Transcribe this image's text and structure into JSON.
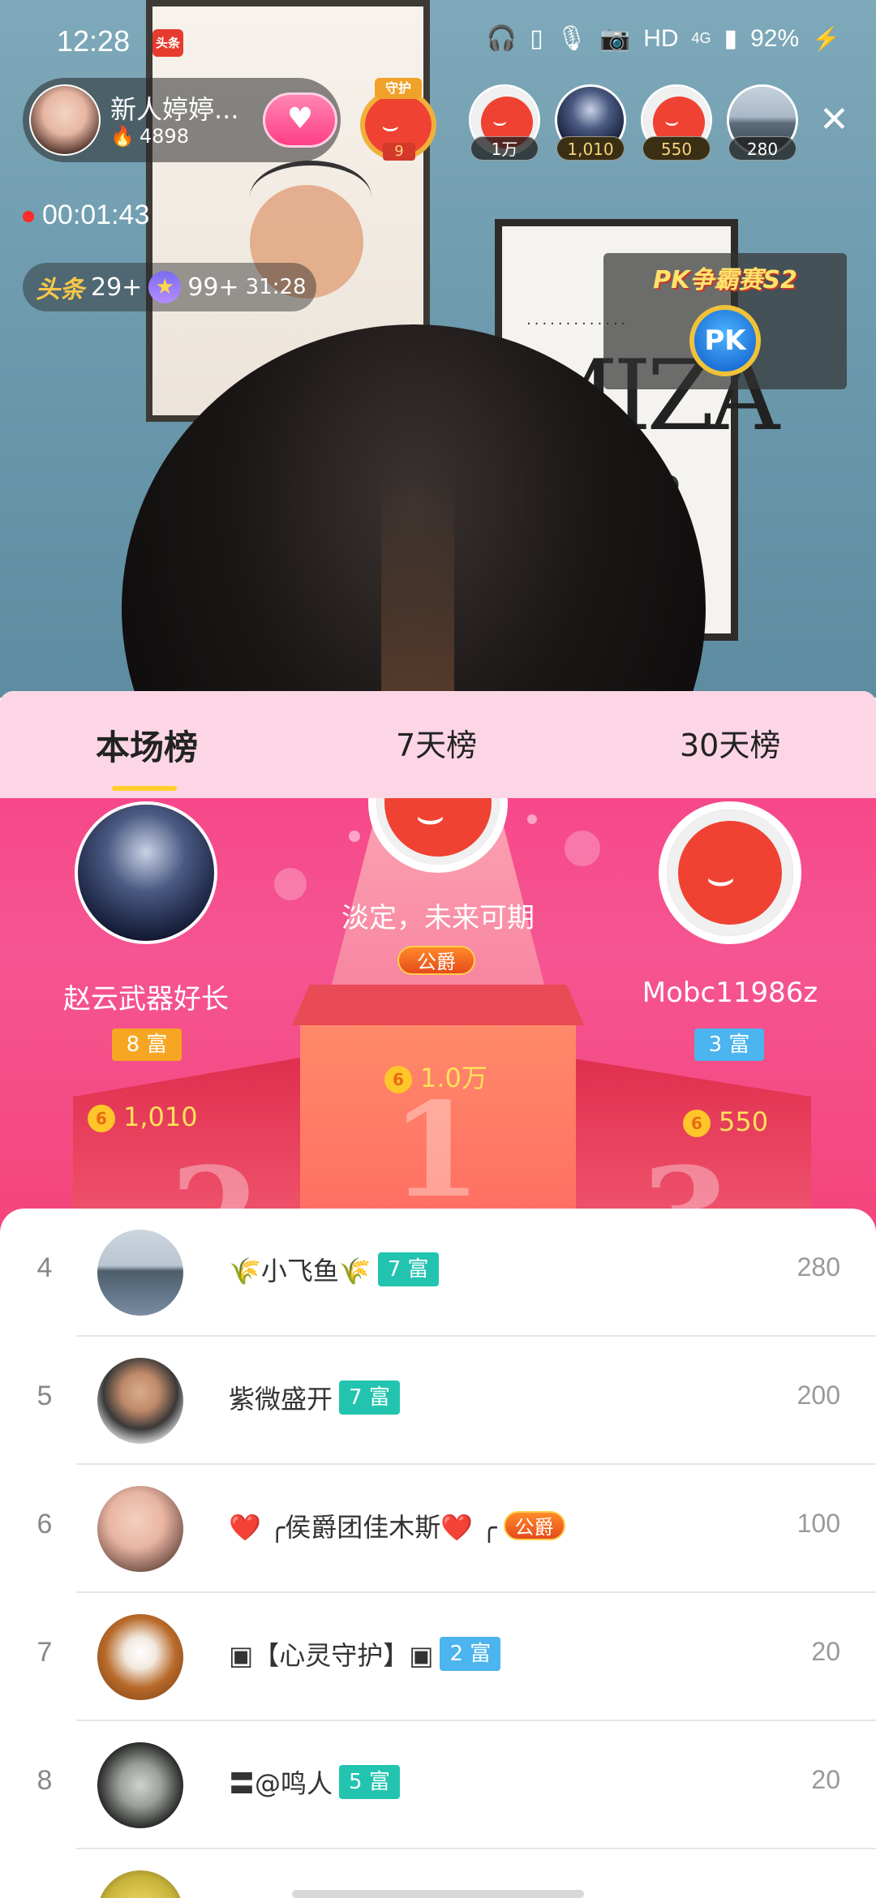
{
  "status_bar": {
    "time": "12:28",
    "app_icon_text": "头条",
    "network": "HD",
    "signal": "4G",
    "battery": "92%"
  },
  "host": {
    "name": "新人婷婷...",
    "heat": "4898"
  },
  "guard": {
    "label": "守护",
    "count": "9"
  },
  "viewers": [
    {
      "label": "1万",
      "avatar": "red-smile-icon"
    },
    {
      "label": "1,010",
      "avatar": "anime"
    },
    {
      "label": "550",
      "avatar": "red-smile-icon"
    },
    {
      "label": "280",
      "avatar": "lake"
    }
  ],
  "live": {
    "duration": "00:01:43"
  },
  "badges": {
    "toutiao_label": "头条",
    "toutiao_count": "29+",
    "star_count": "99+",
    "star_time": "31:28"
  },
  "pk": {
    "title": "PK争霸赛S2",
    "button": "PK"
  },
  "tabs": [
    {
      "label": "本场榜",
      "active": true
    },
    {
      "label": "7天榜",
      "active": false
    },
    {
      "label": "30天榜",
      "active": false
    }
  ],
  "podium": {
    "first": {
      "name": "淡定，未来可期",
      "title_badge": "公爵",
      "score": "1.0万",
      "rank": "1"
    },
    "second": {
      "name": "赵云武器好长",
      "rich": "8 富",
      "score": "1,010",
      "rank": "2"
    },
    "third": {
      "name": "Mobc11986z",
      "rich": "3 富",
      "score": "550",
      "rank": "3"
    }
  },
  "list": [
    {
      "rank": "4",
      "name": "🌾小飞鱼🌾",
      "badge": "7 富",
      "badge_type": "teal",
      "value": "280"
    },
    {
      "rank": "5",
      "name": "紫微盛开",
      "badge": "7 富",
      "badge_type": "teal",
      "value": "200"
    },
    {
      "rank": "6",
      "name": "❤️ ╭侯爵团佳木斯❤️ ╭",
      "badge": "公爵",
      "badge_type": "duke",
      "value": "100"
    },
    {
      "rank": "7",
      "name": "▣【心灵守护】▣",
      "badge": "2 富",
      "badge_type": "blue",
      "value": "20"
    },
    {
      "rank": "8",
      "name": "〓@鸣人",
      "badge": "5 富",
      "badge_type": "teal",
      "value": "20"
    }
  ]
}
